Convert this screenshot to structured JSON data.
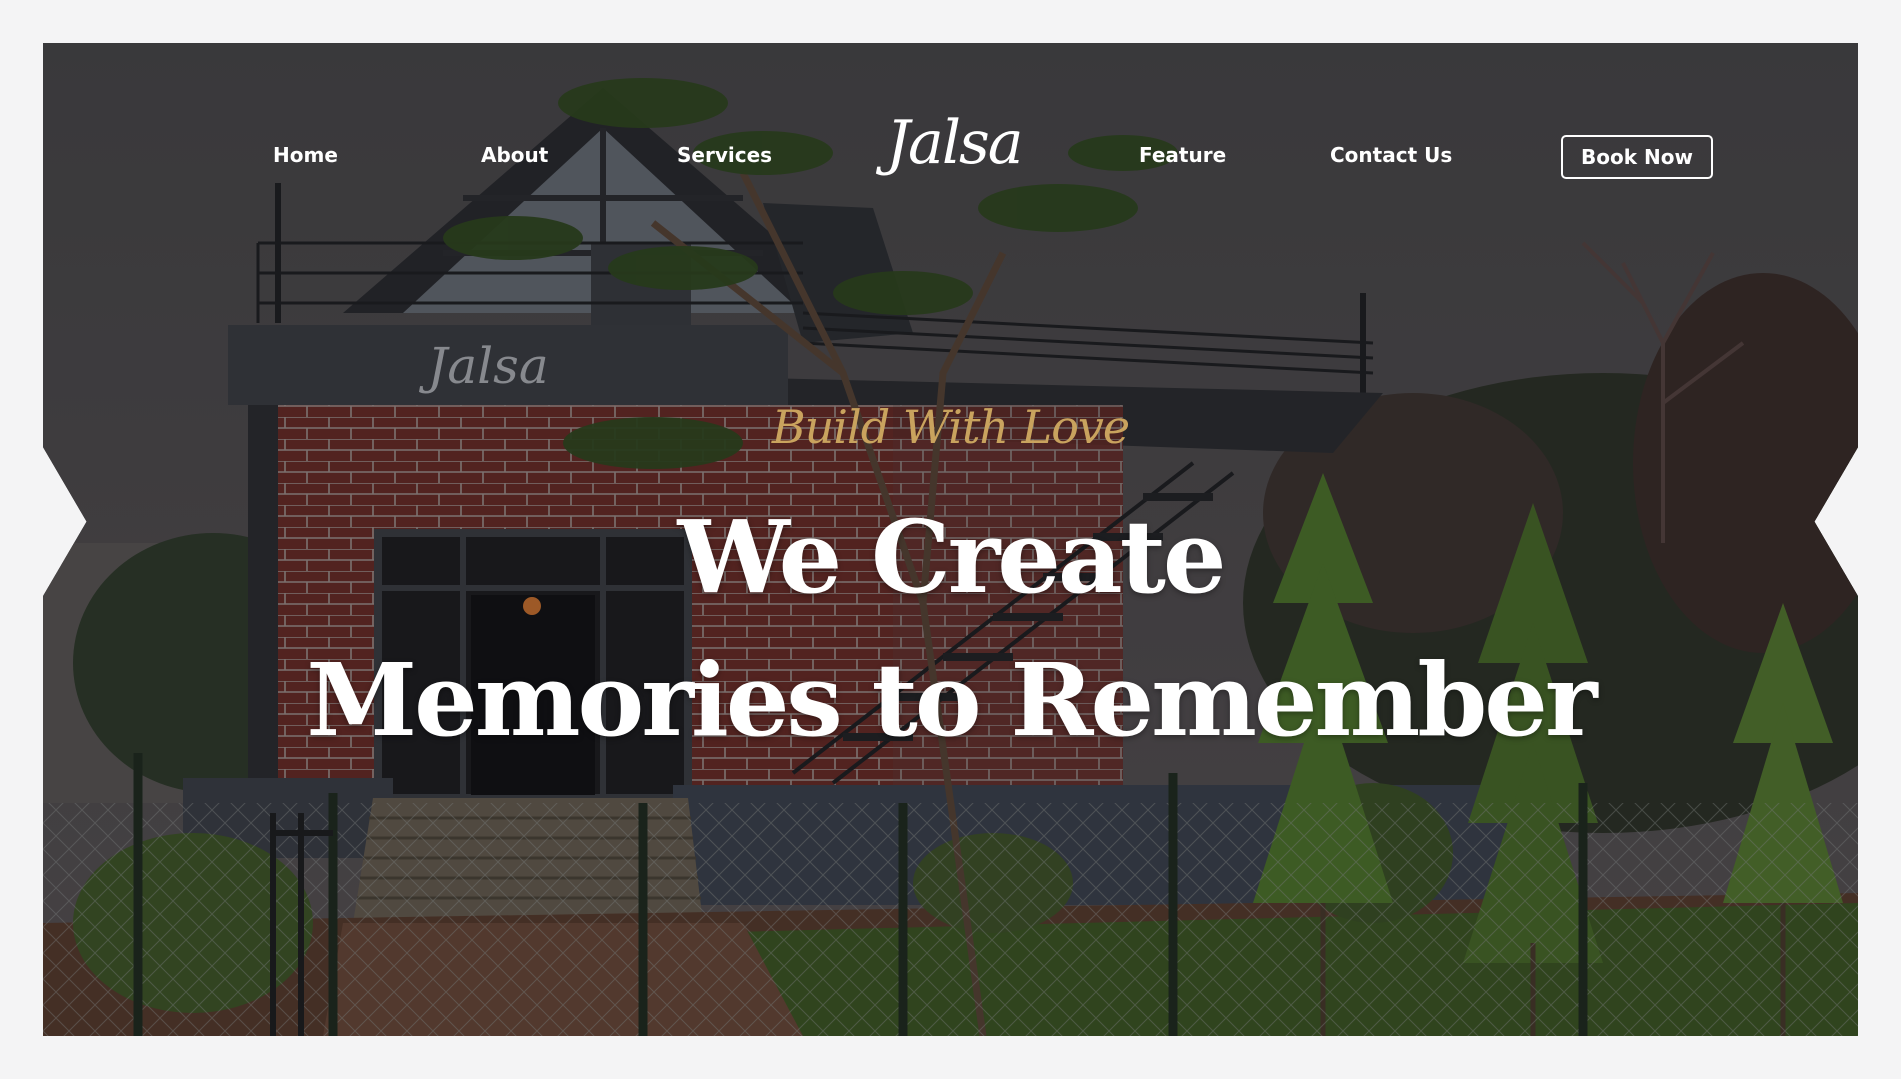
{
  "nav": {
    "home": "Home",
    "about": "About",
    "services": "Services",
    "feature": "Feature",
    "contact": "Contact Us",
    "book_now": "Book Now"
  },
  "logo": {
    "text": "Jalsa"
  },
  "building_sign": {
    "text": "Jalsa"
  },
  "hero": {
    "tagline": "Build With Love",
    "headline_line1": "We Create",
    "headline_line2": "Memories to Remember"
  },
  "colors": {
    "page_background": "#f4f4f5",
    "overlay_text": "#ffffff",
    "tagline_gold": "#c9a35e",
    "brick": "#6e2a24"
  }
}
